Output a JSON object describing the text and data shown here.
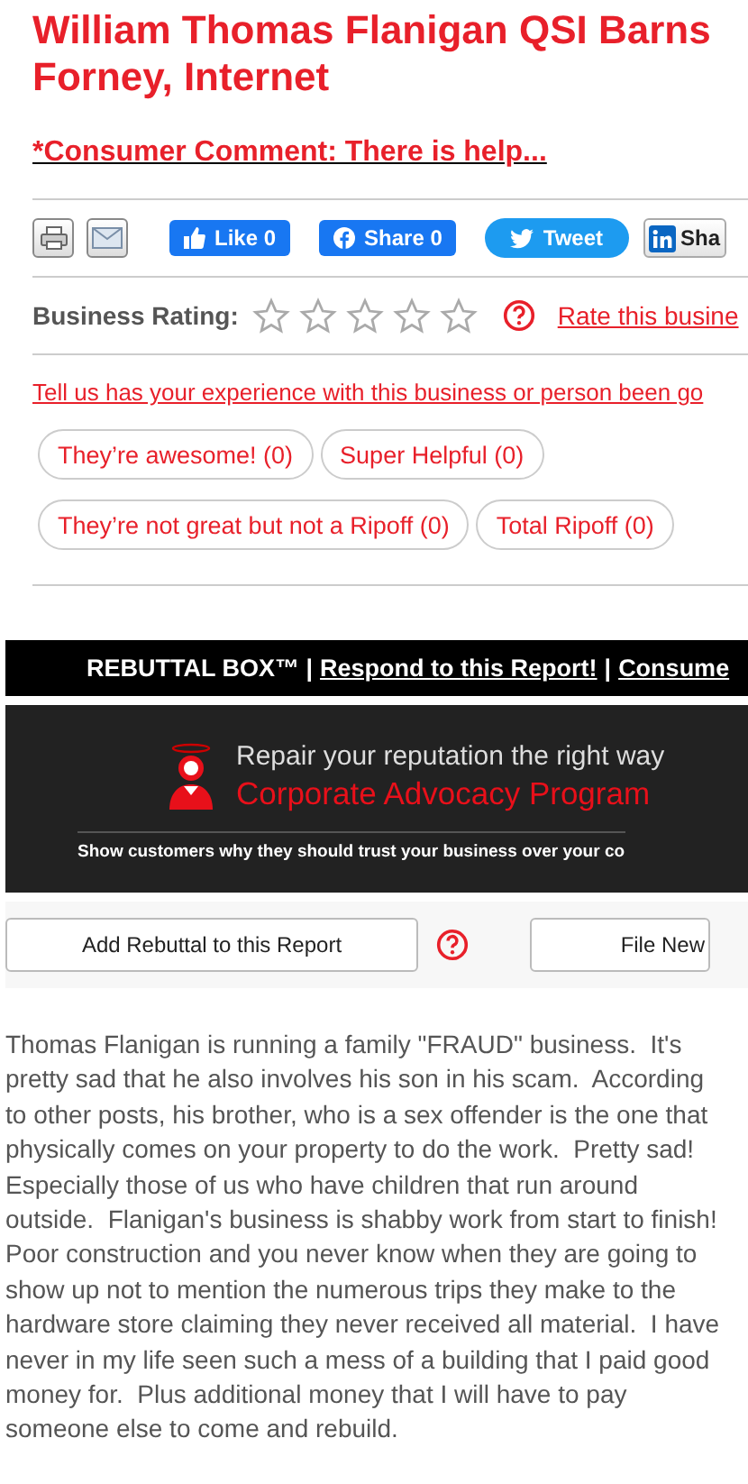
{
  "title": "William Thomas Flanigan QSI Barns Forney, Internet",
  "comment_link": "*Consumer Comment: There is help...",
  "share_bar": [
    {
      "kind": "print"
    },
    {
      "kind": "email"
    },
    {
      "kind": "like",
      "label": "Like 0"
    },
    {
      "kind": "share",
      "label": "Share 0"
    },
    {
      "kind": "tweet",
      "label": "Tweet"
    },
    {
      "kind": "linkedin",
      "label": "Sha"
    }
  ],
  "rating": {
    "label": "Business Rating:",
    "stars": 0,
    "rate_link": "Rate this busine"
  },
  "experience_link": "Tell us has your experience with this business or person been go",
  "reactions": [
    {
      "label": "They’re awesome! (0)"
    },
    {
      "label": "Super Helpful (0)"
    },
    {
      "label": "They’re not great but not a Ripoff (0)"
    },
    {
      "label": "Total Ripoff (0)"
    }
  ],
  "rebuttal_bar": [
    {
      "kind": "text",
      "text": "REBUTTAL BOX™ |"
    },
    {
      "kind": "link",
      "text": "Respond to this Report!"
    },
    {
      "kind": "text",
      "text": "|"
    },
    {
      "kind": "link",
      "text": "Consume"
    }
  ],
  "banner": {
    "headline": "Repair your reputation the right way",
    "program": "Corporate Advocacy Program",
    "tagline": "Show customers why they should trust your business over your co"
  },
  "actions": [
    {
      "kind": "button",
      "label": "Add Rebuttal to this Report"
    },
    {
      "kind": "help"
    },
    {
      "kind": "button",
      "label": "File New"
    }
  ],
  "report_text": "Thomas Flanigan is running a family \"FRAUD\" business.  It's pretty sad that he also involves his son in his scam.  According to other posts, his brother, who is a sex offender is the one that physically comes on your property to do the work.  Pretty sad!  Especially those of us who have children that run around outside.  Flanigan's business is shabby work from start to finish!  Poor construction and you never know when they are going to show up not to mention the numerous trips they make to the hardware store claiming they never received all material.  I have never in my life seen such a mess of a building that I paid good money for.  Plus additional money that I will have to pay someone else to come and rebuild."
}
